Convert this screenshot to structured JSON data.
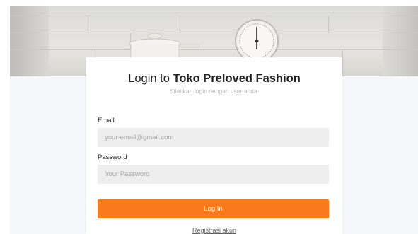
{
  "login": {
    "title_prefix": "Login to ",
    "title_brand": "Toko Preloved Fashion",
    "subtitle": "Silahkan login dengan user anda.",
    "email_label": "Email",
    "email_placeholder": "your-email@gmail.com",
    "password_label": "Password",
    "password_placeholder": "Your Password",
    "submit_label": "Log In",
    "register_link": "Registrasi akun"
  },
  "colors": {
    "accent": "#f97a1b",
    "input_bg": "#eeeeee",
    "page_bg": "#f5f6f9"
  }
}
